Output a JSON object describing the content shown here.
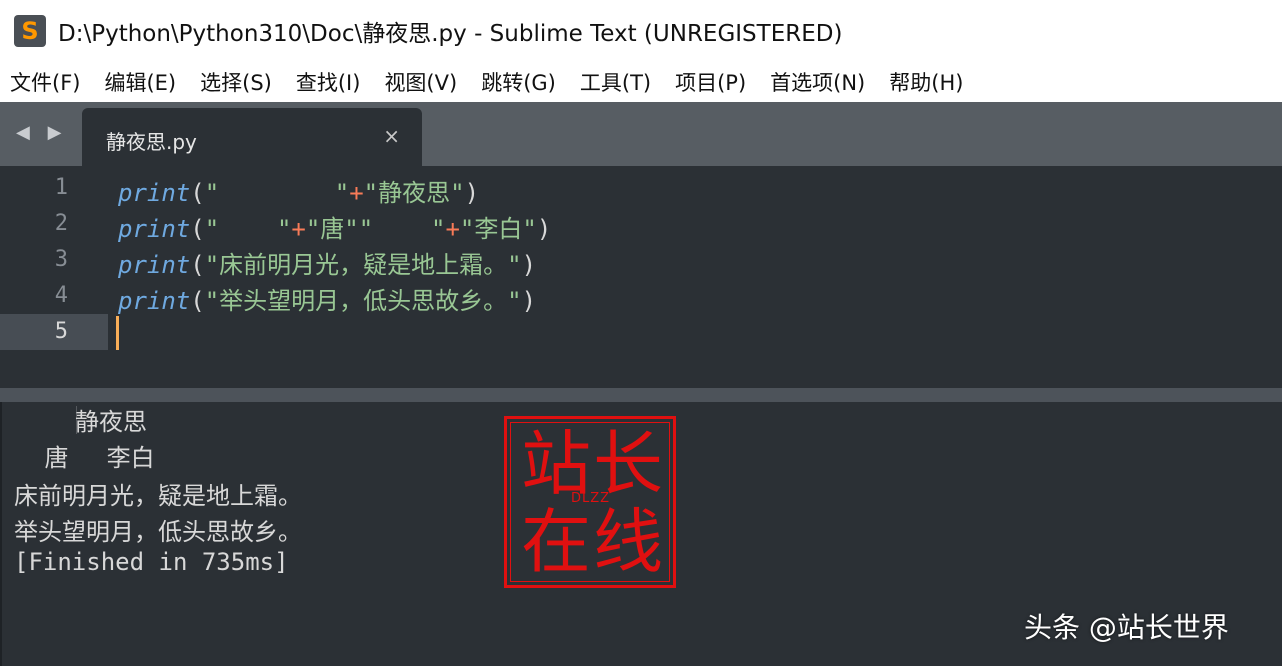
{
  "window": {
    "title": "D:\\Python\\Python310\\Doc\\静夜思.py - Sublime Text (UNREGISTERED)",
    "icon": "sublime-text-icon",
    "icon_glyph": "S"
  },
  "menu": {
    "items": [
      {
        "label": "文件(F)"
      },
      {
        "label": "编辑(E)"
      },
      {
        "label": "选择(S)"
      },
      {
        "label": "查找(I)"
      },
      {
        "label": "视图(V)"
      },
      {
        "label": "跳转(G)"
      },
      {
        "label": "工具(T)"
      },
      {
        "label": "项目(P)"
      },
      {
        "label": "首选项(N)"
      },
      {
        "label": "帮助(H)"
      }
    ]
  },
  "tabs": {
    "nav_arrows": "◀ ▶",
    "active": {
      "label": "静夜思.py",
      "close": "×"
    }
  },
  "editor": {
    "lines": [
      {
        "num": "1",
        "kw": "print",
        "open": "(",
        "s1": "\"        \"",
        "op1": "+",
        "s2": "\"静夜思\"",
        "op2": "",
        "s3": "",
        "close": ")"
      },
      {
        "num": "2",
        "kw": "print",
        "open": "(",
        "s1": "\"    \"",
        "op1": "+",
        "s2": "\"唐\"\"    \"",
        "op2": "+",
        "s3": "\"李白\"",
        "close": ")"
      },
      {
        "num": "3",
        "kw": "print",
        "open": "(",
        "s1": "\"床前明月光，疑是地上霜。\"",
        "op1": "",
        "s2": "",
        "op2": "",
        "s3": "",
        "close": ")"
      },
      {
        "num": "4",
        "kw": "print",
        "open": "(",
        "s1": "\"举头望明月，低头思故乡。\"",
        "op1": "",
        "s2": "",
        "op2": "",
        "s3": "",
        "close": ")"
      },
      {
        "num": "5",
        "kw": "",
        "open": "",
        "s1": "",
        "op1": "",
        "s2": "",
        "op2": "",
        "s3": "",
        "close": ""
      }
    ],
    "active_line": "5",
    "colors": {
      "keyword": "#6fa9e0",
      "string": "#99c794",
      "operator": "#f97b58",
      "cursor": "#f9ae58"
    }
  },
  "output": {
    "lines": [
      "        静夜思",
      "    唐     李白",
      "床前明月光，疑是地上霜。",
      "举头望明月，低头思故乡。",
      "[Finished in 735ms]"
    ]
  },
  "seal": {
    "chars": [
      "站",
      "长",
      "在",
      "线"
    ],
    "mark": "DLZZ",
    "color": "#e01010"
  },
  "watermark": {
    "text": "头条 @站长世界"
  }
}
